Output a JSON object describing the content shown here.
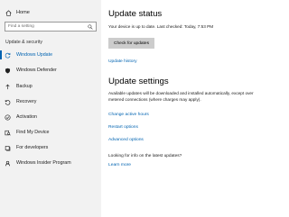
{
  "sidebar": {
    "home_label": "Home",
    "search_placeholder": "Find a setting",
    "section_label": "Update & security",
    "items": [
      {
        "label": "Windows Update",
        "icon": "refresh-icon",
        "active": true
      },
      {
        "label": "Windows Defender",
        "icon": "shield-icon"
      },
      {
        "label": "Backup",
        "icon": "backup-arrow-icon"
      },
      {
        "label": "Recovery",
        "icon": "recovery-icon"
      },
      {
        "label": "Activation",
        "icon": "check-circle-icon"
      },
      {
        "label": "Find My Device",
        "icon": "find-device-icon"
      },
      {
        "label": "For developers",
        "icon": "developer-tools-icon"
      },
      {
        "label": "Windows Insider Program",
        "icon": "insider-icon"
      }
    ]
  },
  "main": {
    "status_title": "Update status",
    "status_text": "Your device is up to date. Last checked: Today, 7:53 PM",
    "check_button": "Check for updates",
    "update_history_link": "Update history",
    "settings_title": "Update settings",
    "settings_desc": "Available updates will be downloaded and installed automatically, except over metered connections (where charges may apply).",
    "links": {
      "active_hours": "Change active hours",
      "restart_options": "Restart options",
      "advanced_options": "Advanced options"
    },
    "question": "Looking for info on the latest updates?",
    "learn_more": "Learn more"
  },
  "colors": {
    "accent": "#0063b1",
    "sidebar_bg": "#f2f2f2",
    "button_bg": "#cccccc"
  }
}
